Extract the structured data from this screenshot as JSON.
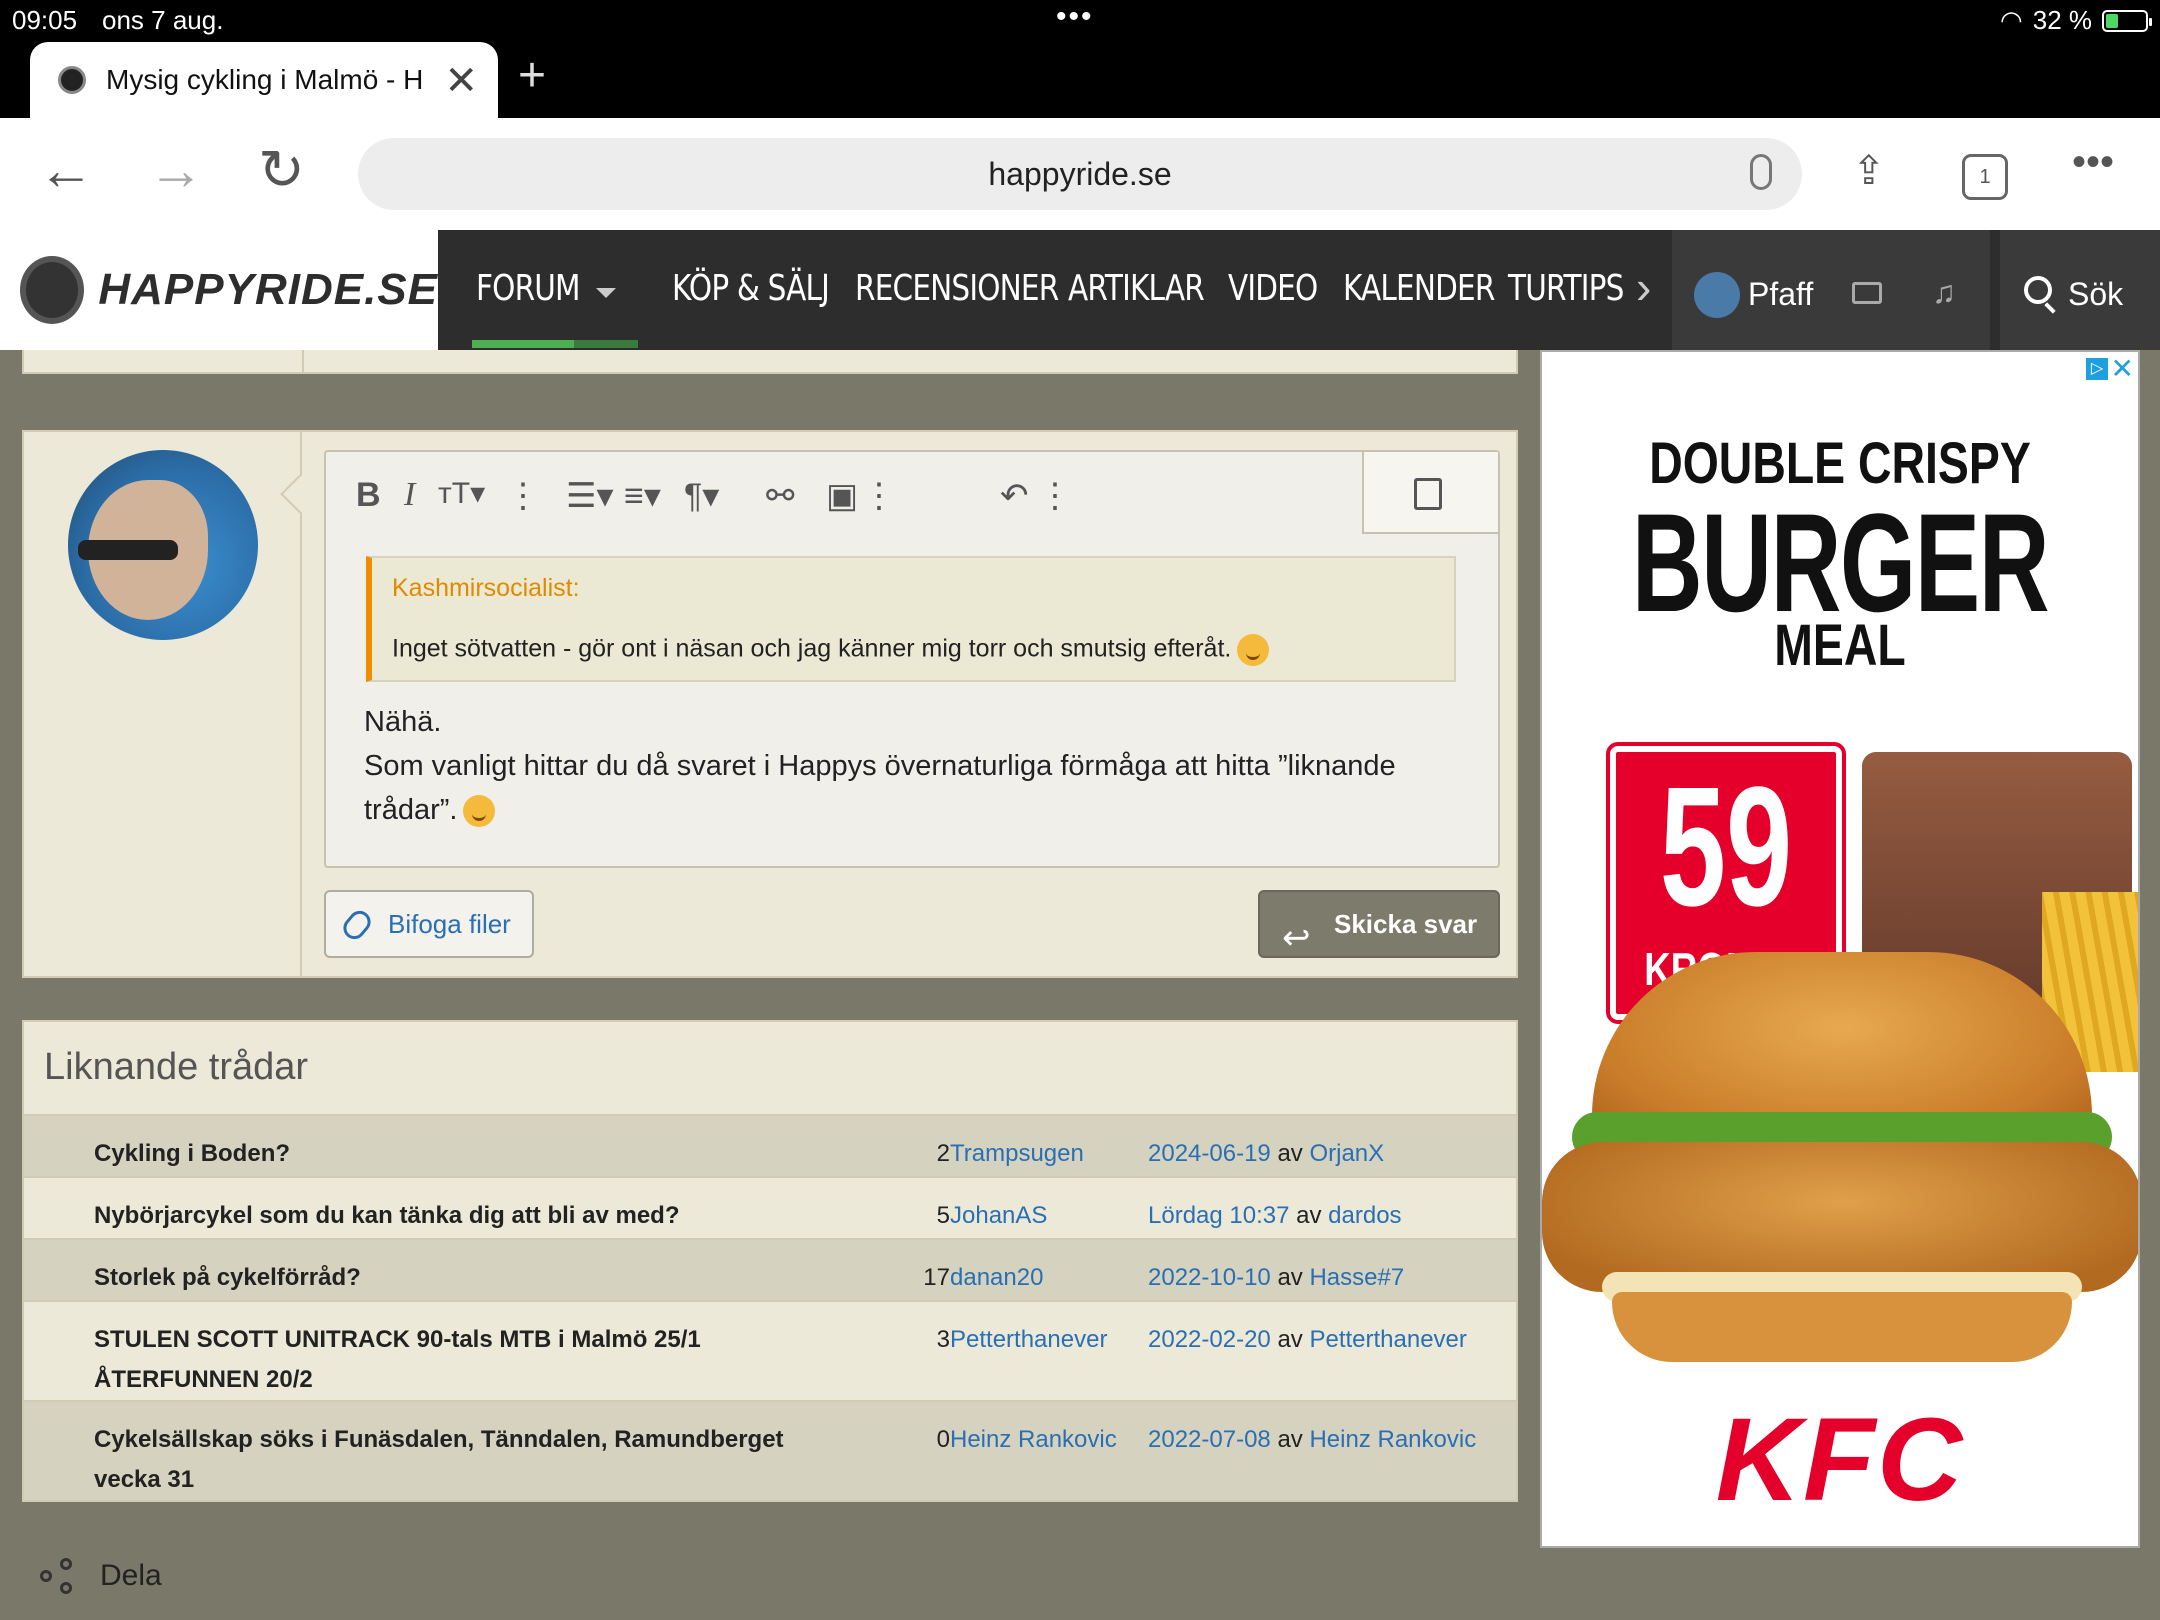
{
  "status": {
    "time": "09:05",
    "date": "ons 7 aug.",
    "battery": "32 %"
  },
  "browser": {
    "tab_title": "Mysig cykling i Malmö - H",
    "url": "happyride.se",
    "tab_count": "1"
  },
  "site": {
    "logo_text": "HAPPYRIDE.SE",
    "nav": [
      "FORUM",
      "KÖP & SÄLJ",
      "RECENSIONER",
      "ARTIKLAR",
      "VIDEO",
      "KALENDER",
      "TURTIPS"
    ],
    "user": "Pfaff",
    "search_label": "Sök"
  },
  "reply": {
    "quote_author": "Kashmirsocialist:",
    "quote_text": "Inget sötvatten - gör ont i näsan och jag känner mig torr och smutsig efteråt.",
    "line1": "Nähä.",
    "line2": "Som vanligt hittar du då svaret i Happys övernaturliga förmåga att hitta ”liknande trådar”.",
    "attach_label": "Bifoga filer",
    "submit_label": "Skicka svar"
  },
  "similar": {
    "title": "Liknande trådar",
    "rows": [
      {
        "title": "Cykling i Boden?",
        "count": "2",
        "author": "Trampsugen",
        "last_date": "2024-06-19",
        "by": "av",
        "last_user": "OrjanX"
      },
      {
        "title": "Nybörjarcykel som du kan tänka dig att bli av med?",
        "count": "5",
        "author": "JohanAS",
        "last_date": "Lördag 10:37",
        "by": "av",
        "last_user": "dardos"
      },
      {
        "title": "Storlek på cykelförråd?",
        "count": "17",
        "author": "danan20",
        "last_date": "2022-10-10",
        "by": "av",
        "last_user": "Hasse#7"
      },
      {
        "title": "STULEN SCOTT UNITRACK 90-tals MTB i Malmö 25/1 ÅTERFUNNEN 20/2",
        "count": "3",
        "author": "Petterthanever",
        "last_date": "2022-02-20",
        "by": "av",
        "last_user": "Petterthanever"
      },
      {
        "title": "Cykelsällskap söks i Funäsdalen, Tänndalen, Ramundberget vecka 31",
        "count": "0",
        "author": "Heinz Rankovic",
        "last_date": "2022-07-08",
        "by": "av",
        "last_user": "Heinz Rankovic"
      }
    ]
  },
  "share_label": "Dela",
  "ad": {
    "line1": "DOUBLE CRISPY",
    "line2": "BURGER",
    "line3": "MEAL",
    "price": "59",
    "currency": "KRONOR",
    "brand": "KFC",
    "brand_color": "#e4002b"
  }
}
